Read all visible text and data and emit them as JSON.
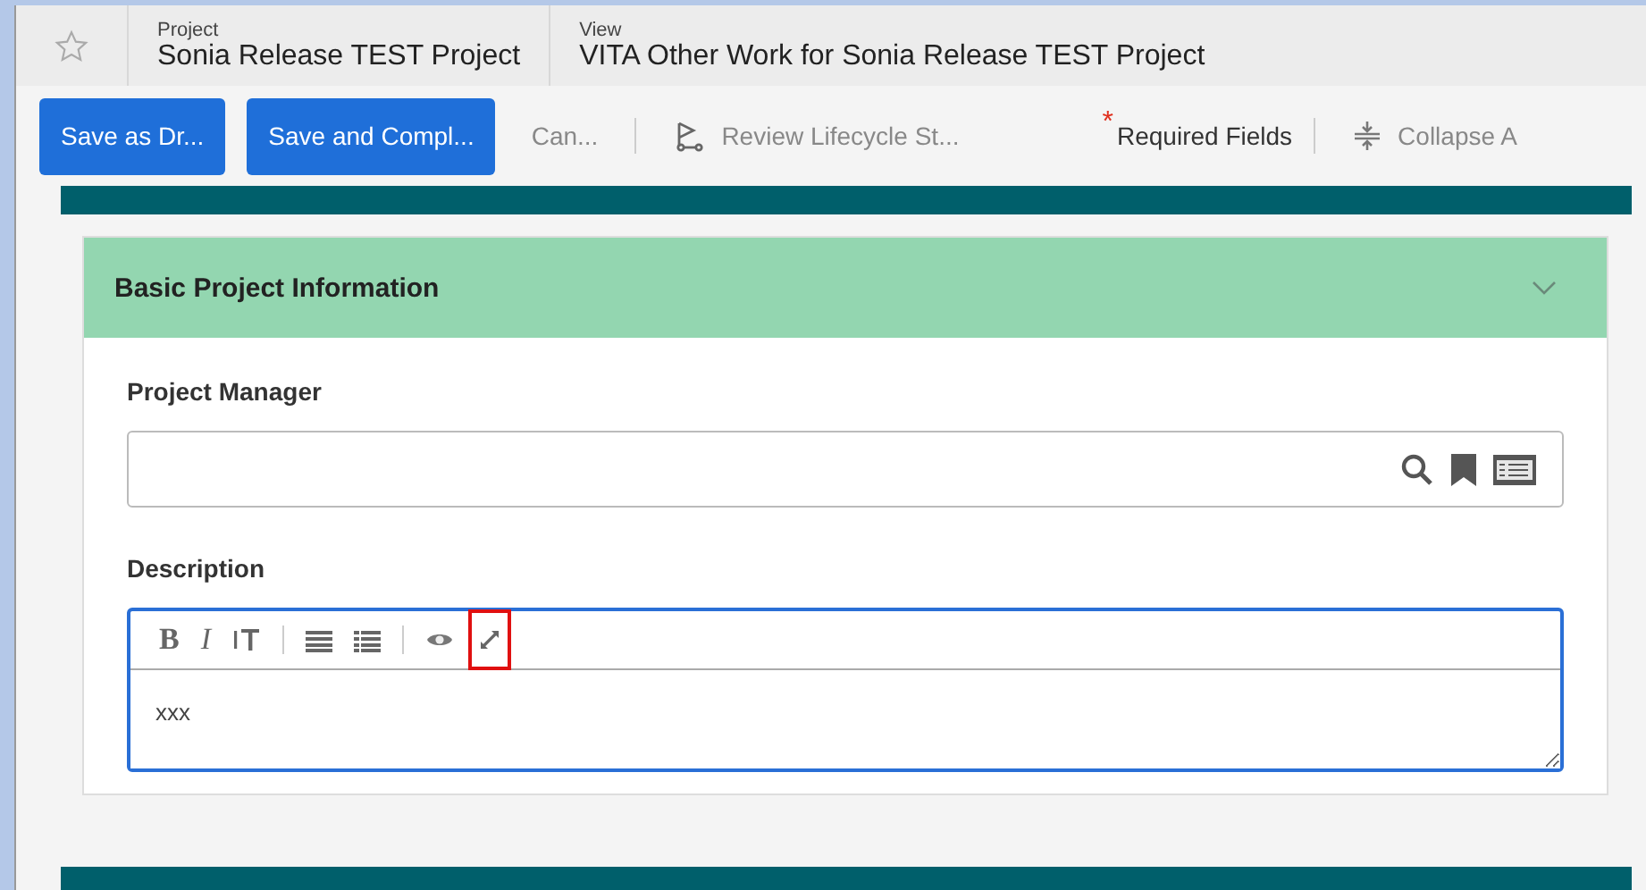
{
  "header": {
    "favorite": false,
    "crumbs": [
      {
        "label": "Project",
        "value": "Sonia Release TEST Project"
      },
      {
        "label": "View",
        "value": "VITA Other Work for Sonia Release TEST Project"
      }
    ]
  },
  "toolbar": {
    "primary_buttons": [
      "Save as Dr...",
      "Save and Compl..."
    ],
    "cancel": "Can...",
    "review": "Review Lifecycle St...",
    "required_mark": "*",
    "required": "Required Fields",
    "collapse": "Collapse A"
  },
  "section": {
    "title": "Basic Project Information",
    "expanded": true,
    "fields": [
      {
        "kind": "lookup",
        "label": "Project Manager"
      },
      {
        "kind": "richtext",
        "label": "Description",
        "value": "xxx",
        "focused": true,
        "format_buttons": [
          "B",
          "I"
        ],
        "highlight_expand": true
      }
    ]
  }
}
